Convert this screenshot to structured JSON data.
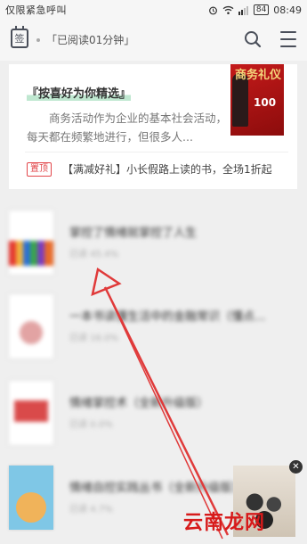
{
  "status_bar": {
    "left_text": "仅限紧急呼叫",
    "battery": "84",
    "time": "08:49"
  },
  "header": {
    "sign_label": "签",
    "read_time": "「已阅读01分钟」"
  },
  "feature": {
    "title": "『按喜好为你精选』",
    "description": "商务活动作为企业的基本社会活动，每天都在频繁地进行，但很多人...",
    "cover_title": "商务礼仪",
    "cover_number": "100",
    "pin_badge": "置顶",
    "promo_text": "【满减好礼】小长假路上读的书，全场1折起"
  },
  "books": [
    {
      "title": "掌控了情绪就掌控了人生",
      "progress": "已读 45.4%"
    },
    {
      "title": "一本书读懂生活中的金融常识（懂点...",
      "progress": "已读 16.0%"
    },
    {
      "title": "情绪掌控术（全新升级版）",
      "progress": "已读 0.0%"
    },
    {
      "title": "情绪自控实践丛书（全新升级版）册",
      "progress": "已读 4.7%"
    }
  ],
  "watermark": {
    "text": "云南龙网"
  },
  "colors": {
    "accent_red": "#d71a1a",
    "arrow_red": "#e03a3a",
    "highlight_green": "#bfe7d0"
  }
}
